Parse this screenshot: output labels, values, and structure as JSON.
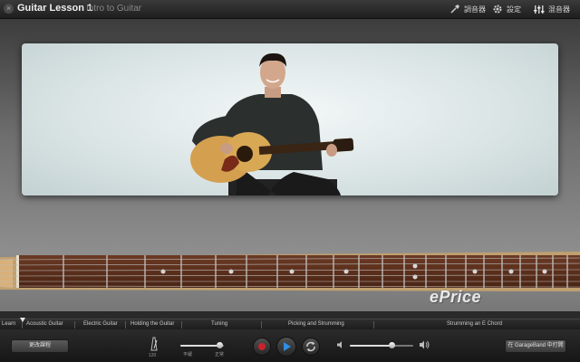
{
  "header": {
    "title": "Guitar Lesson 1",
    "subtitle": "Intro to Guitar",
    "actions": [
      {
        "label": "調音器",
        "icon": "tuner-icon"
      },
      {
        "label": "設定",
        "icon": "gear-icon"
      },
      {
        "label": "混音器",
        "icon": "mixer-icon"
      }
    ]
  },
  "lessons": {
    "items": [
      "Learn",
      "Acoustic Guitar",
      "Electric Guitar",
      "Holding the Guitar",
      "Tuning",
      "Picking and Strumming",
      "Strumming an E Chord"
    ]
  },
  "controls": {
    "change_lesson_label": "更改課程",
    "metronome_value": "120",
    "tempo_slow_label": "平緩",
    "tempo_normal_label": "正常",
    "open_garageband_label": "在 GarageBand 中打開",
    "tempo_level": 0.9,
    "volume_level": 0.65
  },
  "watermark": "ePrice",
  "colors": {
    "accent_blue": "#2f8de4",
    "record_red": "#c8232b"
  }
}
